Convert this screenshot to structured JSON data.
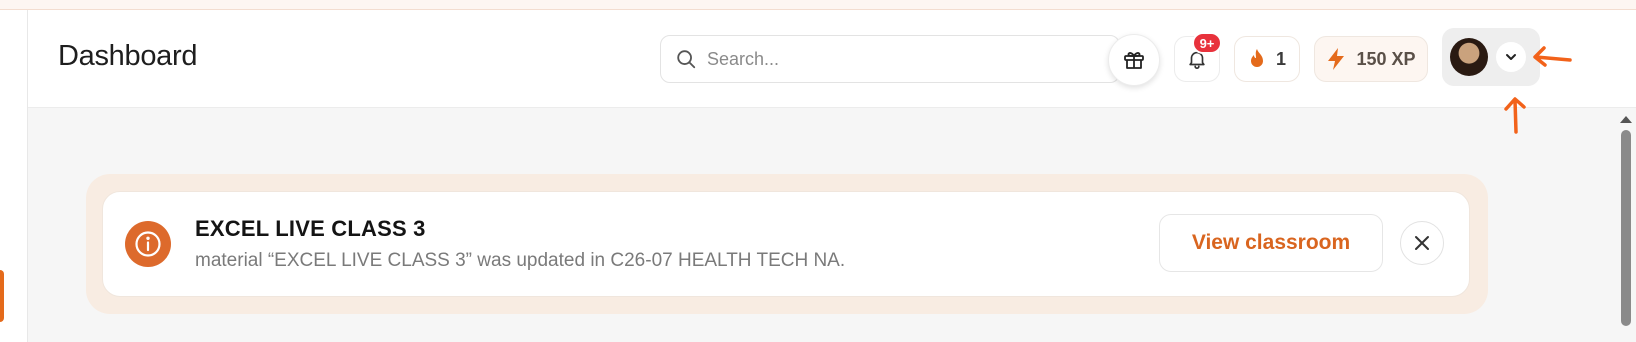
{
  "header": {
    "title": "Dashboard",
    "search": {
      "placeholder": "Search...",
      "value": ""
    },
    "notifications": {
      "badge": "9+"
    },
    "streak": {
      "count": "1"
    },
    "xp": {
      "label": "150 XP"
    }
  },
  "banner": {
    "title": "EXCEL LIVE CLASS 3",
    "message": "material “EXCEL LIVE CLASS 3” was updated in C26-07 HEALTH TECH NA.",
    "action_label": "View classroom"
  },
  "colors": {
    "accent": "#dd6a2c",
    "badge": "#e8323c",
    "annotation": "#f2621a"
  },
  "icons": [
    "search-icon",
    "gift-icon",
    "bell-icon",
    "flame-icon",
    "lightning-icon",
    "chevron-down-icon",
    "info-icon",
    "close-icon"
  ]
}
